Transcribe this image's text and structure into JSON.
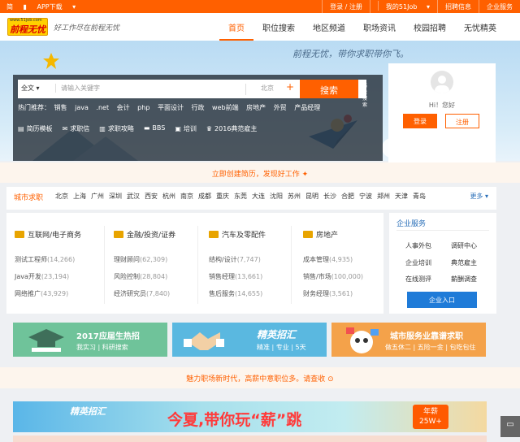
{
  "topbar": {
    "lang": "简",
    "app": "APP下载",
    "login_reg": "登录 / 注册",
    "my51": "我的51Job",
    "recruit": "招聘信息",
    "corp": "企业服务"
  },
  "header": {
    "logo_url_text": "www.51job.com",
    "logo": "前程无忧",
    "slogan": "好工作尽在前程无忧",
    "nav": [
      "首页",
      "职位搜索",
      "地区频道",
      "职场资讯",
      "校园招聘",
      "无忧精英"
    ]
  },
  "hero": {
    "tagline": "前程无忧，带你求职带你飞。"
  },
  "search": {
    "scope": "全文",
    "placeholder": "请输入关键字",
    "city": "北京",
    "plus": "+",
    "button": "搜索",
    "advanced": "高级搜索",
    "hot_label": "热门推荐：",
    "hot": [
      "销售",
      "java",
      ".net",
      "会计",
      "php",
      "平面设计",
      "行政",
      "web前端",
      "房地产",
      "外贸",
      "产品经理"
    ],
    "quick": [
      {
        "icon": "resume-icon",
        "label": "简历模板"
      },
      {
        "icon": "mail-icon",
        "label": "求职信"
      },
      {
        "icon": "book-icon",
        "label": "求职攻略"
      },
      {
        "icon": "chat-icon",
        "label": "BBS"
      },
      {
        "icon": "train-icon",
        "label": "培训"
      },
      {
        "icon": "trophy-icon",
        "label": "2016典范雇主"
      }
    ]
  },
  "login": {
    "greeting": "Hi！您好",
    "login": "登录",
    "register": "注册"
  },
  "resume_banner": "立即创建简历，发现好工作",
  "city": {
    "title": "城市求职",
    "cities": [
      "北京",
      "上海",
      "广州",
      "深圳",
      "武汉",
      "西安",
      "杭州",
      "南京",
      "成都",
      "重庆",
      "东莞",
      "大连",
      "沈阳",
      "苏州",
      "昆明",
      "长沙",
      "合肥",
      "宁波",
      "郑州",
      "天津",
      "青岛"
    ],
    "more": "更多"
  },
  "categories": [
    {
      "title": "互联网/电子商务",
      "items": [
        {
          "name": "测试工程师",
          "count": "(14,266)"
        },
        {
          "name": "Java开发",
          "count": "(23,194)"
        },
        {
          "name": "网络推广",
          "count": "(43,929)"
        }
      ]
    },
    {
      "title": "金融/投资/证券",
      "items": [
        {
          "name": "理财顾问",
          "count": "(62,309)"
        },
        {
          "name": "风险控制",
          "count": "(28,804)"
        },
        {
          "name": "经济研究员",
          "count": "(7,840)"
        }
      ]
    },
    {
      "title": "汽车及零配件",
      "items": [
        {
          "name": "结构/设计",
          "count": "(7,747)"
        },
        {
          "name": "销售经理",
          "count": "(13,661)"
        },
        {
          "name": "售后服务",
          "count": "(14,655)"
        }
      ]
    },
    {
      "title": "房地产",
      "items": [
        {
          "name": "成本管理",
          "count": "(4,935)"
        },
        {
          "name": "销售/市场",
          "count": "(100,000)"
        },
        {
          "name": "财务经理",
          "count": "(3,561)"
        }
      ]
    }
  ],
  "enterprise": {
    "title": "企业服务",
    "items": [
      "人事外包",
      "调研中心",
      "企业培训",
      "典范雇主",
      "在线测评",
      "薪酬调查"
    ],
    "button": "企业入口"
  },
  "banners": [
    {
      "title": "2017应届生热招",
      "sub": "我实习 | 科研搜索"
    },
    {
      "title": "精英招汇",
      "sub": "精准 | 专业 | 5天"
    },
    {
      "title": "城市服务业靠谱求职",
      "sub": "做五休二 | 五险一金 | 包吃包住"
    }
  ],
  "notice": "魅力职场新时代，高薪中意职位多。请查收",
  "ad": {
    "brand": "精英招汇",
    "headline": "今夏,带你玩“薪”跳",
    "salary_label": "年薪",
    "salary": "25W+"
  },
  "feedback": "意见"
}
